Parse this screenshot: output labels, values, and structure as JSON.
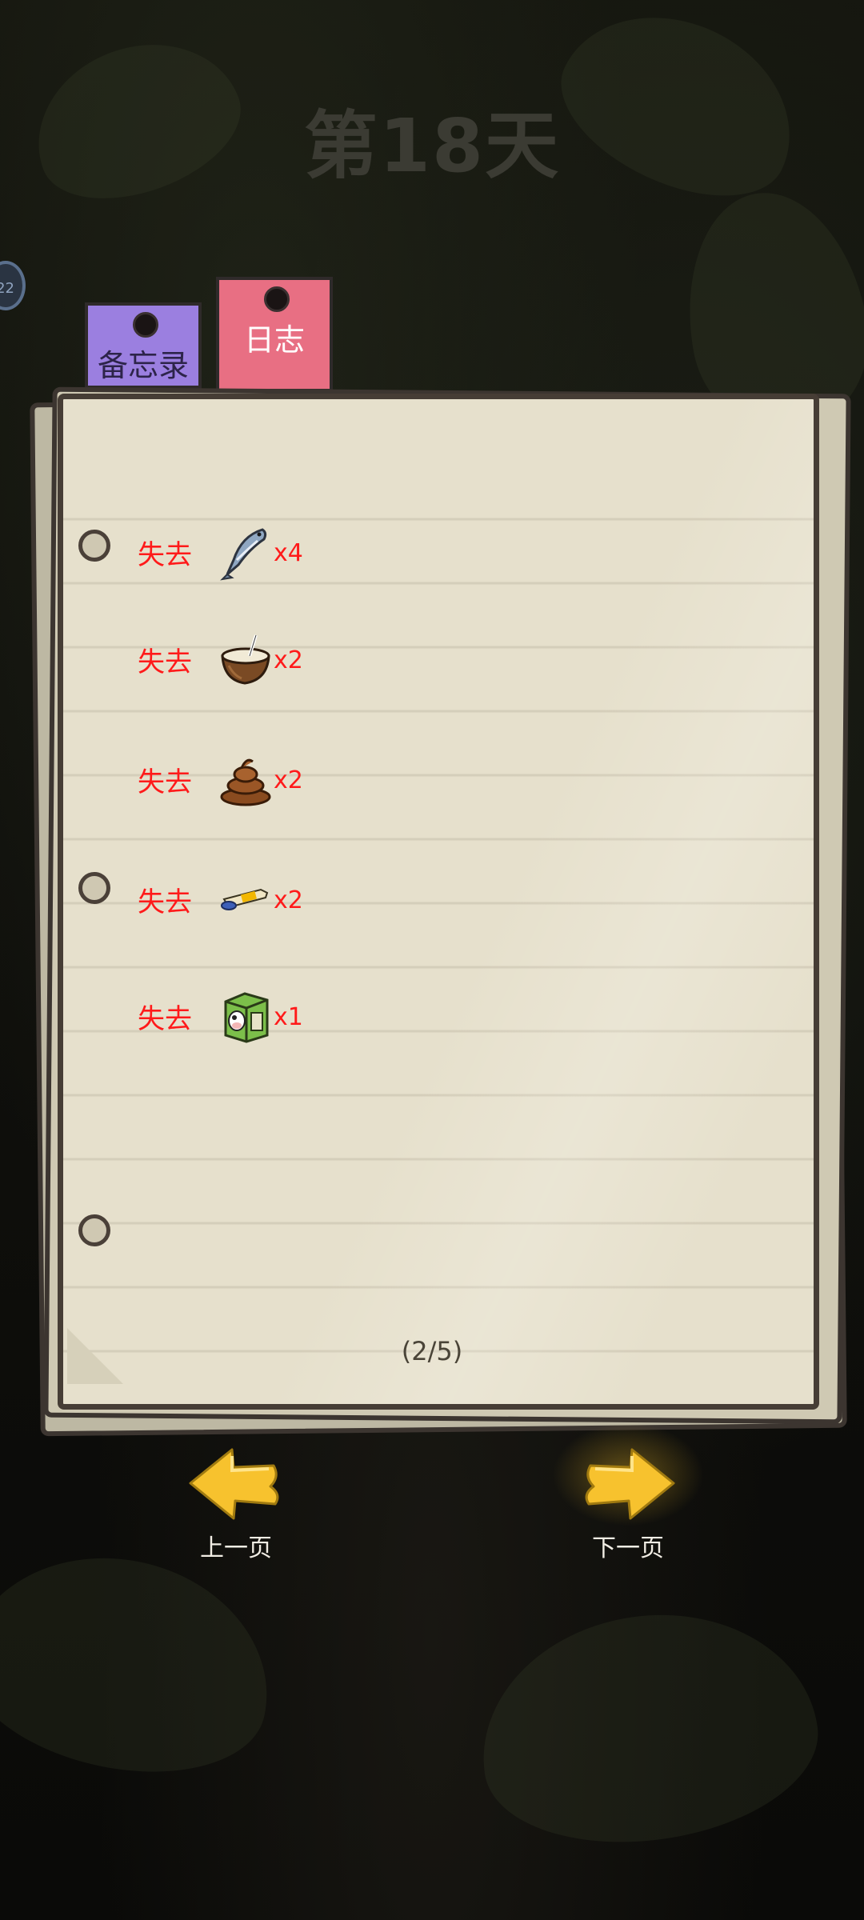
{
  "header": {
    "day_title": "第18天",
    "side_badge": "22"
  },
  "tabs": [
    {
      "label": "备忘录",
      "color": "#9b7fe0",
      "active": false
    },
    {
      "label": "日志",
      "color": "#e86f83",
      "active": true
    }
  ],
  "log_entries": [
    {
      "action": "失去",
      "item_icon": "fish-icon",
      "quantity": "x4"
    },
    {
      "action": "失去",
      "item_icon": "coconut-drink-icon",
      "quantity": "x2"
    },
    {
      "action": "失去",
      "item_icon": "poop-icon",
      "quantity": "x2"
    },
    {
      "action": "失去",
      "item_icon": "ointment-tube-icon",
      "quantity": "x2"
    },
    {
      "action": "失去",
      "item_icon": "milk-carton-icon",
      "quantity": "x1"
    }
  ],
  "pagination": {
    "indicator": "(2/5)",
    "prev_label": "上一页",
    "next_label": "下一页"
  },
  "colors": {
    "loss_text": "#ff1a1a",
    "arrow": "#f7c22e",
    "paper": "#e6e0cc"
  }
}
